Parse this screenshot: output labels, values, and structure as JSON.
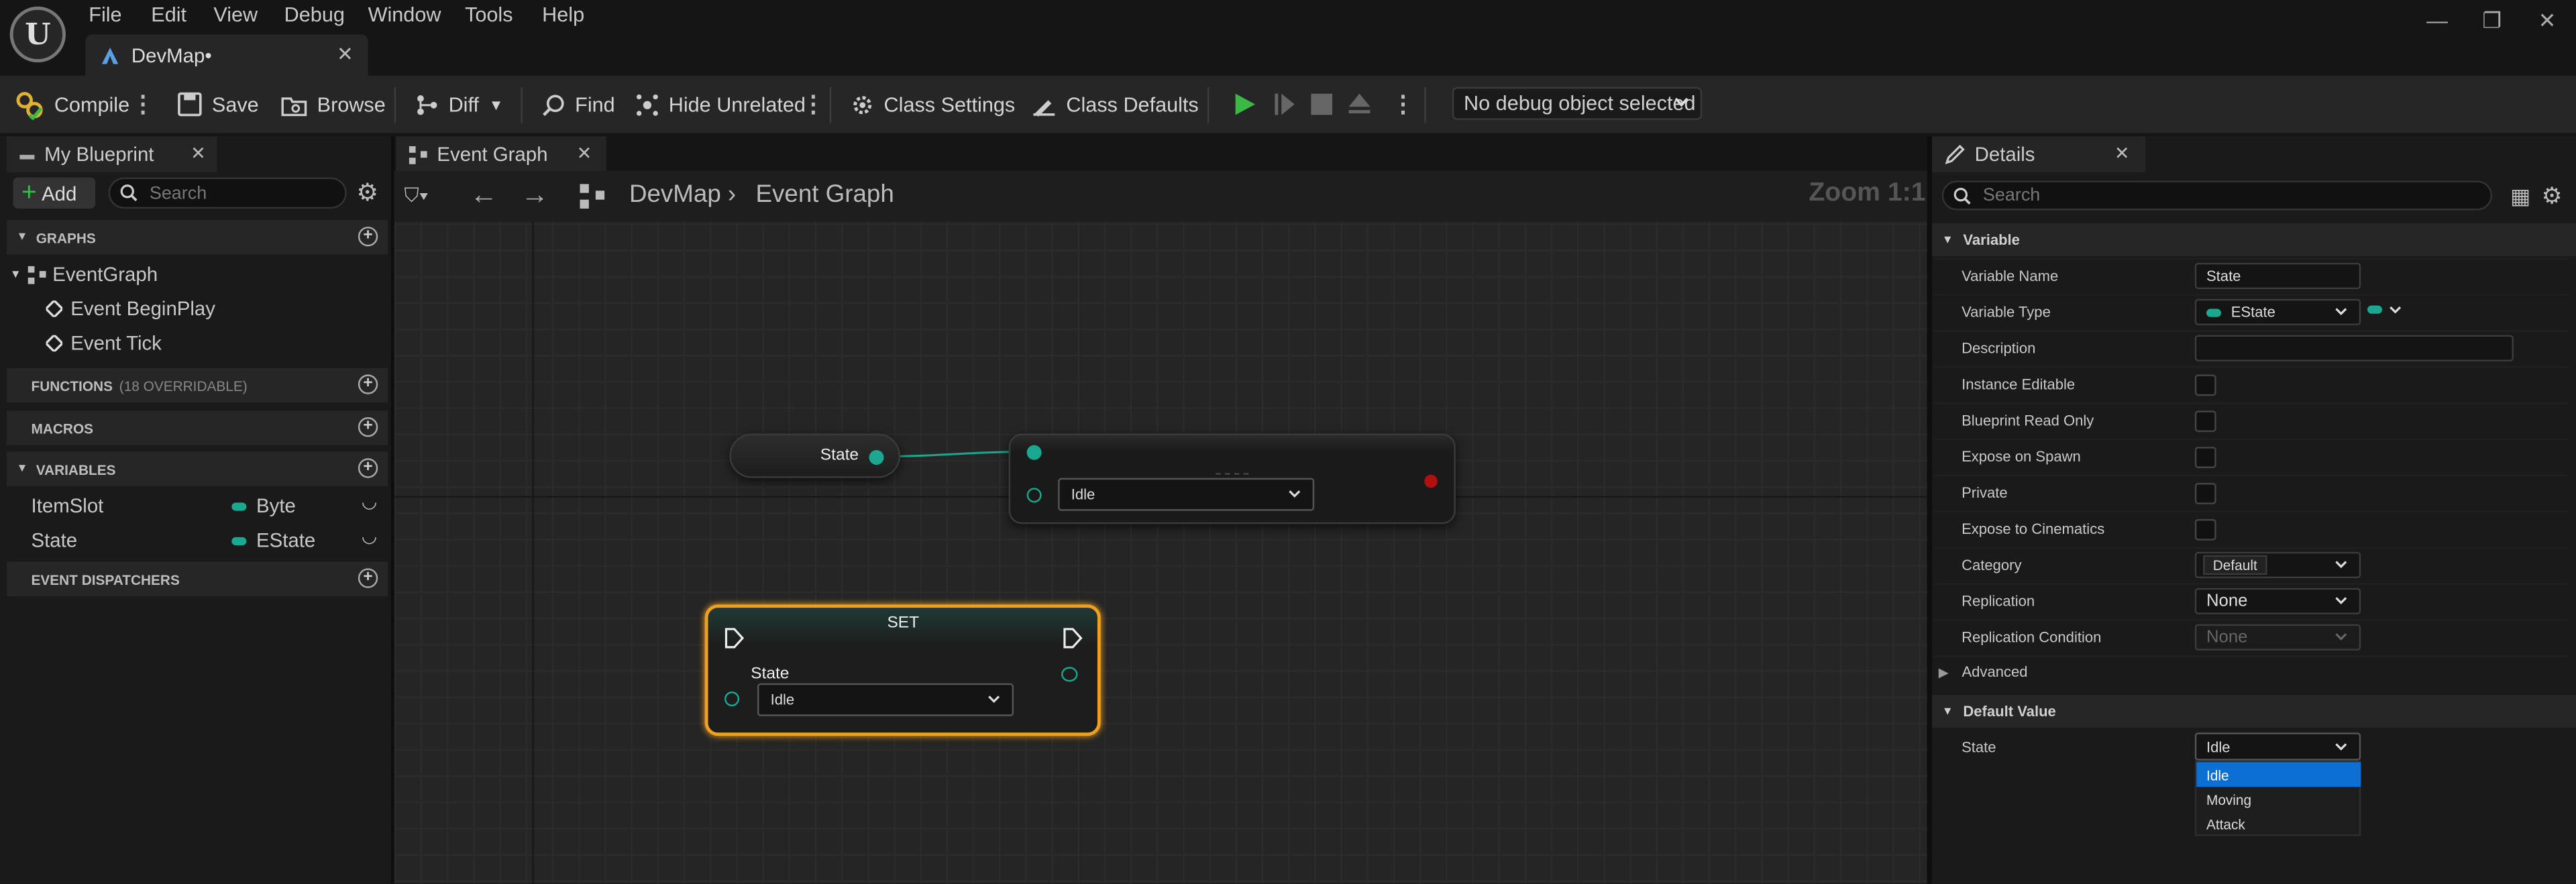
{
  "menu": [
    "File",
    "Edit",
    "View",
    "Debug",
    "Window",
    "Tools",
    "Help"
  ],
  "document_tab": "DevMap•",
  "toolbar": {
    "compile": "Compile",
    "save": "Save",
    "browse": "Browse",
    "diff": "Diff",
    "find": "Find",
    "hide_unrelated": "Hide Unrelated",
    "class_settings": "Class Settings",
    "class_defaults": "Class Defaults",
    "debug_object": "No debug object selected"
  },
  "my_blueprint": {
    "tab": "My Blueprint",
    "add": "Add",
    "search_placeholder": "Search",
    "graphs_header": "GRAPHS",
    "event_graph": "EventGraph",
    "events": [
      "Event BeginPlay",
      "Event Tick"
    ],
    "functions_header": "FUNCTIONS",
    "functions_count": "(18 OVERRIDABLE)",
    "macros_header": "MACROS",
    "variables_header": "VARIABLES",
    "variables": [
      {
        "name": "ItemSlot",
        "type": "Byte"
      },
      {
        "name": "State",
        "type": "EState"
      }
    ],
    "dispatchers_header": "EVENT DISPATCHERS"
  },
  "graph": {
    "tab": "Event Graph",
    "breadcrumb_root": "DevMap",
    "breadcrumb_current": "Event Graph",
    "zoom": "Zoom 1:1",
    "get_node_label": "State",
    "switch_combo": "Idle",
    "set_node_title": "SET",
    "set_node_pin": "State",
    "set_node_combo": "Idle"
  },
  "details": {
    "tab": "Details",
    "search_placeholder": "Search",
    "variable_section": "Variable",
    "rows": {
      "variable_name_label": "Variable Name",
      "variable_name_value": "State",
      "variable_type_label": "Variable Type",
      "variable_type_value": "EState",
      "description_label": "Description",
      "instance_editable_label": "Instance Editable",
      "blueprint_read_only_label": "Blueprint Read Only",
      "expose_on_spawn_label": "Expose on Spawn",
      "private_label": "Private",
      "expose_to_cinematics_label": "Expose to Cinematics",
      "category_label": "Category",
      "category_value": "Default",
      "replication_label": "Replication",
      "replication_value": "None",
      "replication_condition_label": "Replication Condition",
      "replication_condition_value": "None"
    },
    "advanced_section": "Advanced",
    "default_value_section": "Default Value",
    "state_label": "State",
    "state_value": "Idle",
    "dropdown_options": [
      "Idle",
      "Moving",
      "Attack"
    ]
  },
  "colors": {
    "accent_teal": "#1aa890",
    "selection_blue": "#0c6fd3",
    "set_node_outline": "#f0a020",
    "play_green": "#3cb846"
  }
}
